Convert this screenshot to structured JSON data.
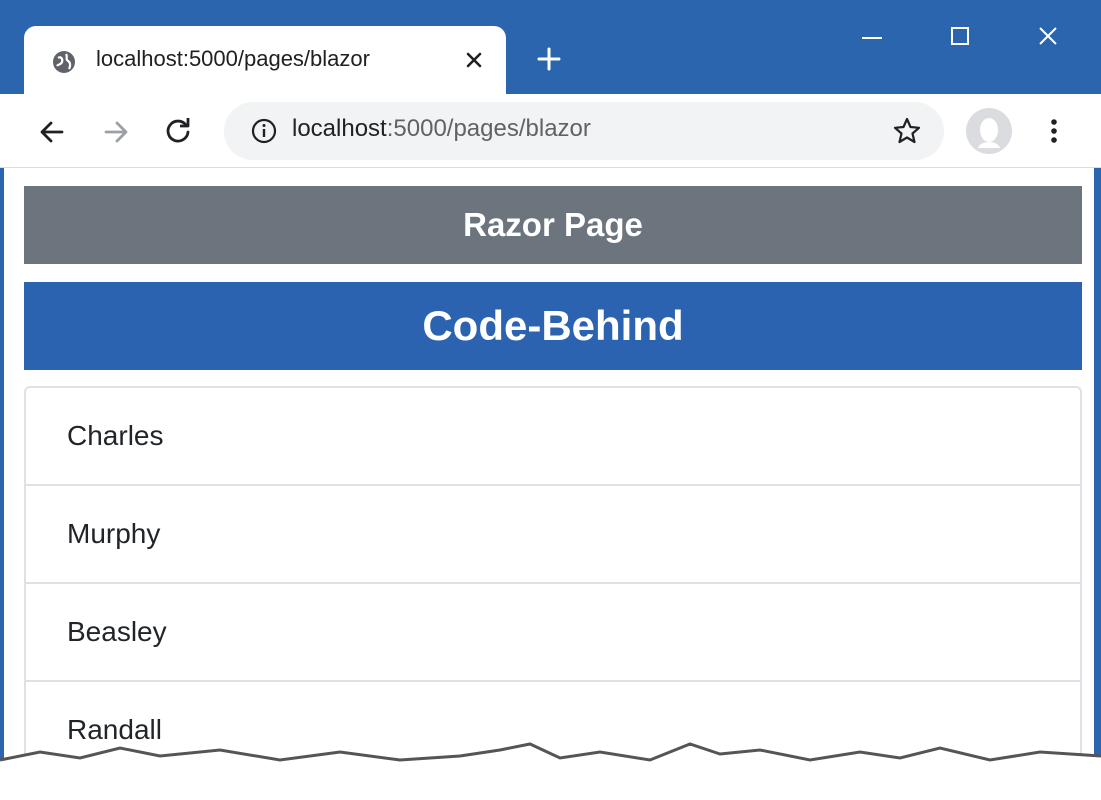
{
  "browser": {
    "tab_title": "localhost:5000/pages/blazor",
    "url_host": "localhost",
    "url_rest": ":5000/pages/blazor",
    "colors": {
      "frame": "#2b65ad",
      "omnibox": "#f1f3f4"
    },
    "icons": {
      "tab": "globe-icon",
      "tab_close": "close-icon",
      "new_tab": "plus-icon",
      "minimize": "minimize-icon",
      "maximize": "maximize-icon",
      "window_close": "close-icon",
      "back": "back-arrow-icon",
      "forward": "forward-arrow-icon",
      "reload": "reload-icon",
      "site_info": "info-icon",
      "bookmark": "star-icon",
      "profile": "avatar-icon",
      "menu": "more-vert-icon"
    }
  },
  "page": {
    "razor_header": "Razor Page",
    "code_behind_header": "Code-Behind",
    "colors": {
      "razor_bg": "#6c757d",
      "code_behind_bg": "#2b63b0"
    },
    "list": [
      "Charles",
      "Murphy",
      "Beasley",
      "Randall"
    ]
  }
}
